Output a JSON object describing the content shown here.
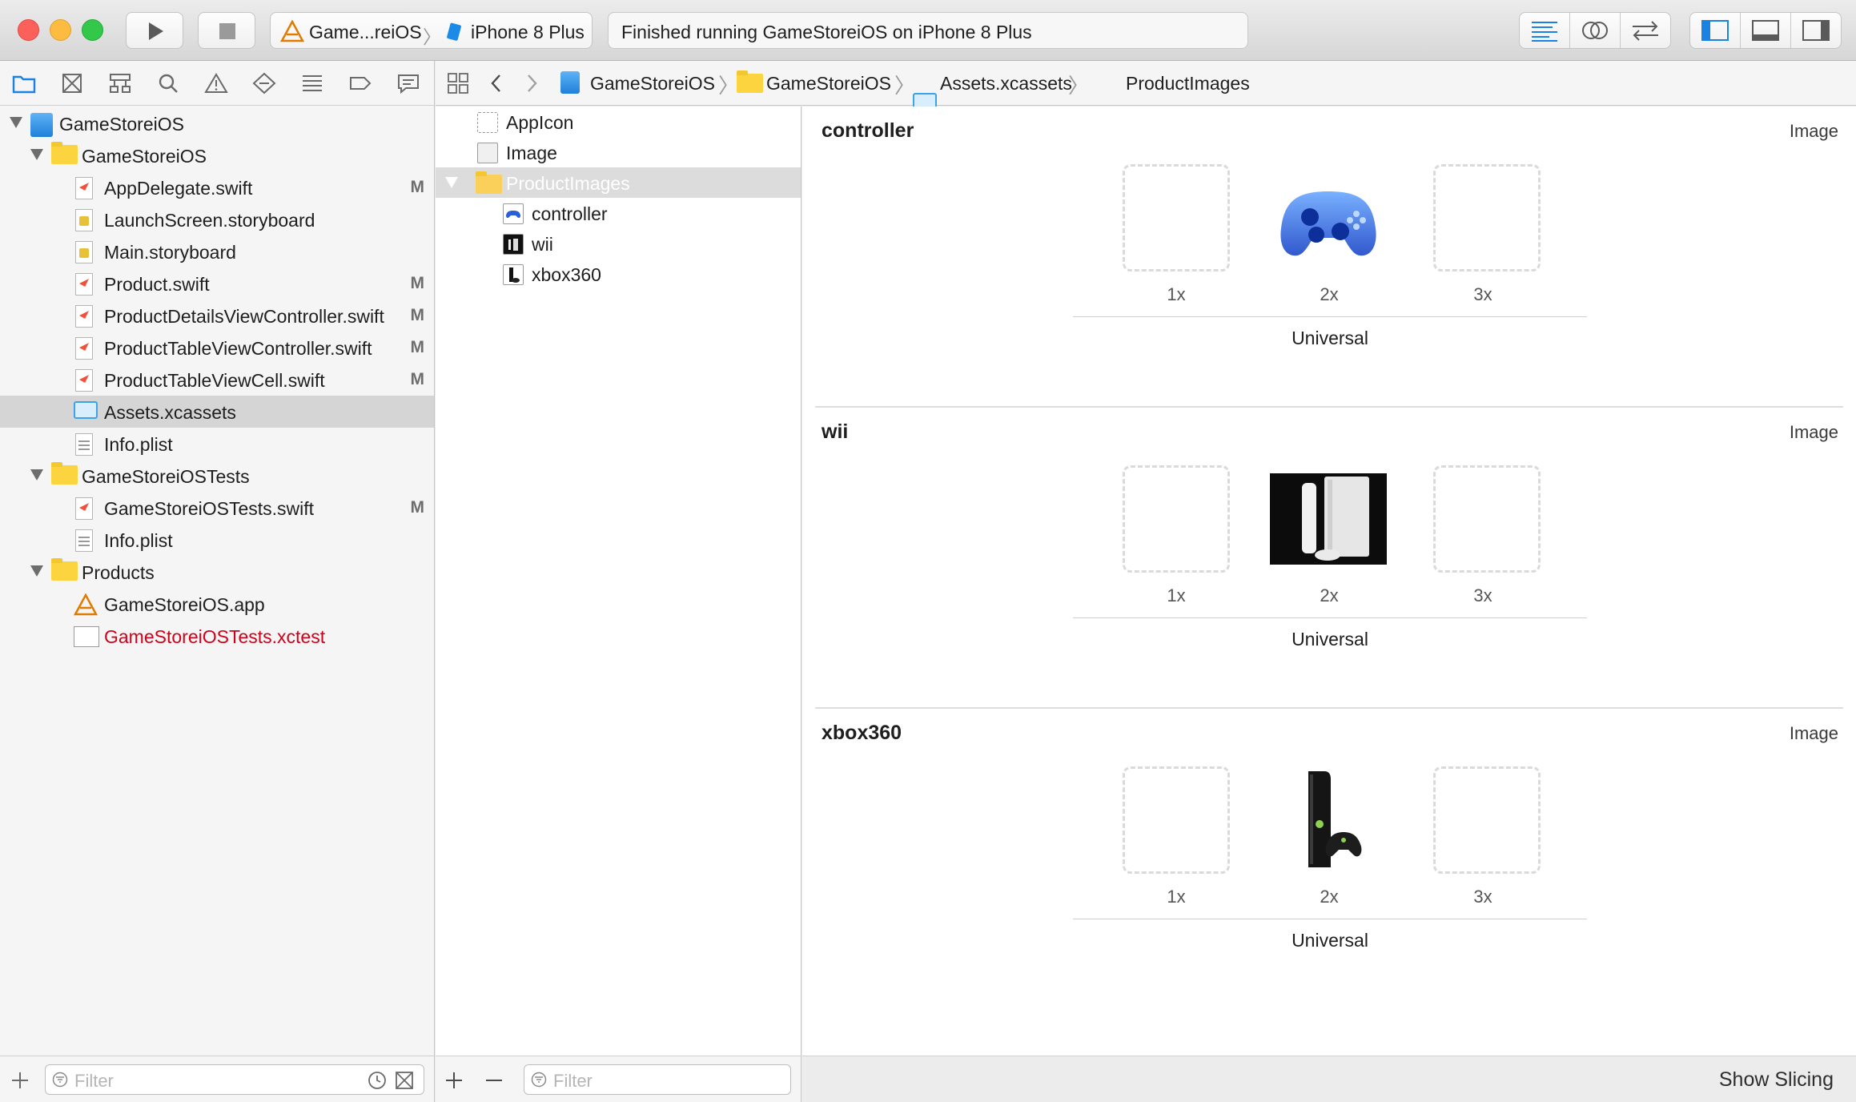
{
  "toolbar": {
    "scheme_name": "Game...reiOS",
    "destination": "iPhone 8 Plus",
    "activity_status": "Finished running GameStoreiOS on iPhone 8 Plus"
  },
  "navigator": {
    "tree": [
      {
        "label": "GameStoreiOS",
        "badge": ""
      },
      {
        "label": "GameStoreiOS",
        "badge": ""
      },
      {
        "label": "AppDelegate.swift",
        "badge": "M"
      },
      {
        "label": "LaunchScreen.storyboard",
        "badge": ""
      },
      {
        "label": "Main.storyboard",
        "badge": ""
      },
      {
        "label": "Product.swift",
        "badge": "M"
      },
      {
        "label": "ProductDetailsViewController.swift",
        "badge": "M"
      },
      {
        "label": "ProductTableViewController.swift",
        "badge": "M"
      },
      {
        "label": "ProductTableViewCell.swift",
        "badge": "M"
      },
      {
        "label": "Assets.xcassets",
        "badge": ""
      },
      {
        "label": "Info.plist",
        "badge": ""
      },
      {
        "label": "GameStoreiOSTests",
        "badge": ""
      },
      {
        "label": "GameStoreiOSTests.swift",
        "badge": "M"
      },
      {
        "label": "Info.plist",
        "badge": ""
      },
      {
        "label": "Products",
        "badge": ""
      },
      {
        "label": "GameStoreiOS.app",
        "badge": ""
      },
      {
        "label": "GameStoreiOSTests.xctest",
        "badge": ""
      }
    ],
    "filter_placeholder": "Filter"
  },
  "jumpbar": {
    "crumbs": [
      "GameStoreiOS",
      "GameStoreiOS",
      "Assets.xcassets",
      "ProductImages"
    ]
  },
  "asset_list": {
    "items": [
      {
        "label": "AppIcon"
      },
      {
        "label": "Image"
      },
      {
        "label": "ProductImages"
      },
      {
        "label": "controller"
      },
      {
        "label": "wii"
      },
      {
        "label": "xbox360"
      }
    ],
    "filter_placeholder": "Filter"
  },
  "detail": {
    "sets": [
      {
        "name": "controller",
        "kind": "Image",
        "scales": [
          "1x",
          "2x",
          "3x"
        ],
        "idiom": "Universal"
      },
      {
        "name": "wii",
        "kind": "Image",
        "scales": [
          "1x",
          "2x",
          "3x"
        ],
        "idiom": "Universal"
      },
      {
        "name": "xbox360",
        "kind": "Image",
        "scales": [
          "1x",
          "2x",
          "3x"
        ],
        "idiom": "Universal"
      }
    ],
    "show_slicing": "Show Slicing"
  },
  "colors": {
    "accent": "#1a82e2",
    "missing_file": "#d0021b",
    "selection": "#d5d5d5"
  }
}
